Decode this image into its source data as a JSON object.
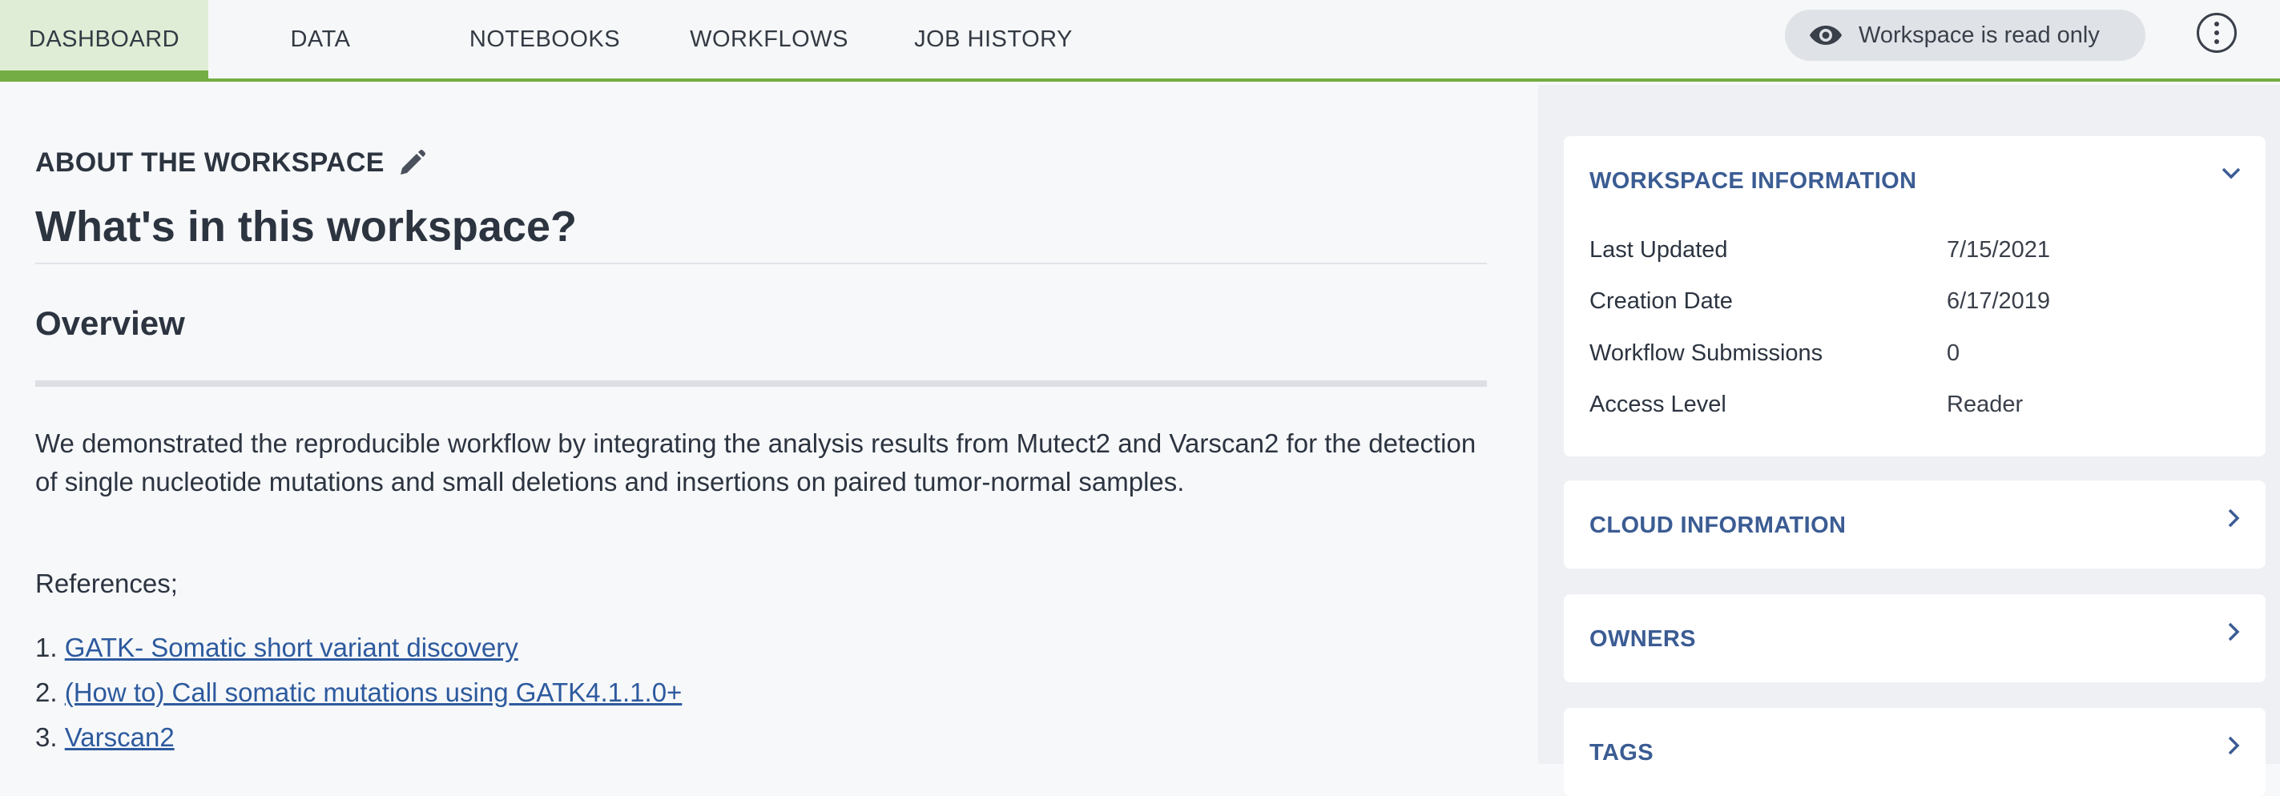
{
  "nav": {
    "tabs": [
      {
        "label": "DASHBOARD",
        "active": true
      },
      {
        "label": "DATA",
        "active": false
      },
      {
        "label": "NOTEBOOKS",
        "active": false
      },
      {
        "label": "WORKFLOWS",
        "active": false
      },
      {
        "label": "JOB HISTORY",
        "active": false
      }
    ],
    "readonly_label": "Workspace is read only",
    "accent_color": "#73ad43"
  },
  "main": {
    "about_label": "ABOUT THE WORKSPACE",
    "heading": "What's in this workspace?",
    "overview_title": "Overview",
    "description": "We demonstrated the reproducible workflow by integrating the analysis results from Mutect2 and Varscan2 for the detection of single nucleotide mutations and small deletions and insertions on paired tumor-normal samples.",
    "references_label": "References;",
    "references": [
      {
        "num": "1.",
        "text": "GATK- Somatic short variant discovery"
      },
      {
        "num": "2.",
        "text": "(How to) Call somatic mutations using GATK4.1.1.0+"
      },
      {
        "num": "3.",
        "text": "Varscan2"
      }
    ]
  },
  "sidebar": {
    "workspace_info": {
      "title": "WORKSPACE INFORMATION",
      "rows": [
        {
          "label": "Last Updated",
          "value": "7/15/2021"
        },
        {
          "label": "Creation Date",
          "value": "6/17/2019"
        },
        {
          "label": "Workflow Submissions",
          "value": "0"
        },
        {
          "label": "Access Level",
          "value": "Reader"
        }
      ]
    },
    "cloud_info": {
      "title": "CLOUD INFORMATION"
    },
    "owners": {
      "title": "OWNERS"
    },
    "tags": {
      "title": "TAGS"
    }
  },
  "icons": [
    "eye-icon",
    "kebab-menu-icon",
    "pencil-icon",
    "chevron-down-icon",
    "chevron-right-icon"
  ]
}
